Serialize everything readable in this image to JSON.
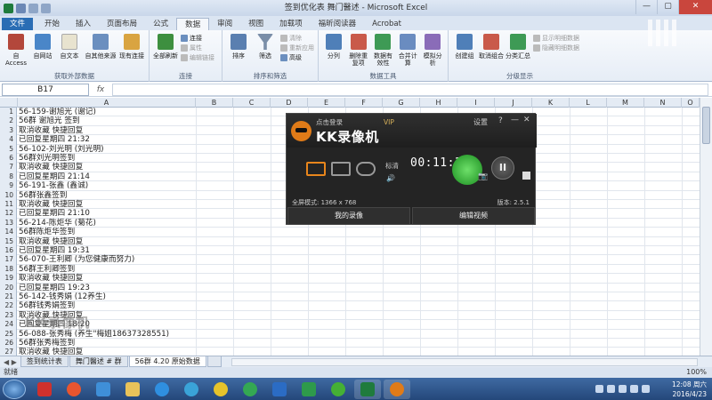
{
  "window": {
    "title": "签到优化表  舞门醫述 - Microsoft Excel",
    "controls": {
      "minimize": "—",
      "maximize": "▢",
      "close": "✕"
    }
  },
  "ribbon_tabs": [
    "文件",
    "开始",
    "插入",
    "页面布局",
    "公式",
    "数据",
    "审阅",
    "视图",
    "加载项",
    "福昕阅读器",
    "Acrobat"
  ],
  "ribbon": {
    "groups": [
      {
        "label": "获取外部数据",
        "buttons": [
          "自 Access",
          "自网站",
          "自文本",
          "自其他来源",
          "现有连接"
        ]
      },
      {
        "label": "连接",
        "buttons": [
          "全部刷新"
        ],
        "small": [
          "连接",
          "属性",
          "编辑链接"
        ]
      },
      {
        "label": "排序和筛选",
        "buttons": [
          "排序",
          "筛选"
        ],
        "small": [
          "清除",
          "重新应用",
          "高级"
        ]
      },
      {
        "label": "数据工具",
        "buttons": [
          "分列",
          "删除重复项",
          "数据有效性",
          "合并计算",
          "模拟分析"
        ]
      },
      {
        "label": "分级显示",
        "buttons": [
          "创建组",
          "取消组合",
          "分类汇总"
        ],
        "small": [
          "显示明细数据",
          "隐藏明细数据"
        ]
      }
    ]
  },
  "formula_bar": {
    "name_box": "B17",
    "fx": "fx",
    "formula": ""
  },
  "columns": [
    "A",
    "B",
    "C",
    "D",
    "E",
    "F",
    "G",
    "H",
    "I",
    "J",
    "K",
    "L",
    "M",
    "N",
    "O"
  ],
  "rows": [
    {
      "n": "1",
      "text": "56-159-谢旭光 (谢记)"
    },
    {
      "n": "2",
      "text": "56群 谢旭光 签到"
    },
    {
      "n": "3",
      "text": "取消收藏 快捷回复"
    },
    {
      "n": "4",
      "text": "已回复星期四 21:32"
    },
    {
      "n": "5",
      "text": "56-102-刘光明 (刘光明)"
    },
    {
      "n": "6",
      "text": "56群刘光明签到"
    },
    {
      "n": "7",
      "text": "取消收藏 快捷回复"
    },
    {
      "n": "8",
      "text": "已回复星期四 21:14"
    },
    {
      "n": "9",
      "text": "56-191-张鑫 (鑫诚)"
    },
    {
      "n": "10",
      "text": "56群张鑫签到"
    },
    {
      "n": "11",
      "text": "取消收藏 快捷回复"
    },
    {
      "n": "12",
      "text": "已回复星期四 21:10"
    },
    {
      "n": "13",
      "text": "56-214-陈炬华 (菊花)"
    },
    {
      "n": "14",
      "text": "56群陈炬华签到"
    },
    {
      "n": "15",
      "text": "取消收藏 快捷回复"
    },
    {
      "n": "16",
      "text": "已回复星期四 19:31"
    },
    {
      "n": "17",
      "text": "56-070-王利卿 (为您健康而努力)"
    },
    {
      "n": "18",
      "text": "56群王利卿签到"
    },
    {
      "n": "19",
      "text": "取消收藏 快捷回复"
    },
    {
      "n": "20",
      "text": "已回复星期四 19:23"
    },
    {
      "n": "21",
      "text": "56-142-钱秀娟 (12养生)"
    },
    {
      "n": "22",
      "text": "56群钱秀娟签到"
    },
    {
      "n": "23",
      "text": "取消收藏 快捷回复"
    },
    {
      "n": "24",
      "text": "已回复星期四 18:20"
    },
    {
      "n": "25",
      "text": "56-088-张秀梅 (养生\"梅姐18637328551)"
    },
    {
      "n": "26",
      "text": "56群张秀梅签到"
    },
    {
      "n": "27",
      "text": "取消收藏 快捷回复"
    }
  ],
  "sheet_tabs": [
    "签到统计表",
    "舞门醫述 # 群",
    "56群 4.20 原始数据"
  ],
  "sheet_nav": "◀ ▶",
  "status": {
    "ready": "就绪",
    "zoom": "100%"
  },
  "kk_recorder": {
    "login": "点击登录",
    "vip": "VIP",
    "name": "KK录像机",
    "settings": "设置",
    "help": "?",
    "minimize": "—",
    "close": "✕",
    "quality": "标清",
    "volume_icon": "🔊",
    "timer": "00:11:36",
    "pause": "II",
    "camera_icon": "📷",
    "fullscreen": "全屏模式: 1366 x 768",
    "version": "版本: 2.5.1",
    "my_recordings": "我的录像",
    "edit_video": "编辑视频"
  },
  "watermark": "KK录像机",
  "clock": {
    "time": "12:08 周六",
    "date": "2016/4/23"
  },
  "colors": {
    "excel_tab": "#2a6db4",
    "record": "#2faa2a",
    "taskbar": "#2c528a"
  }
}
